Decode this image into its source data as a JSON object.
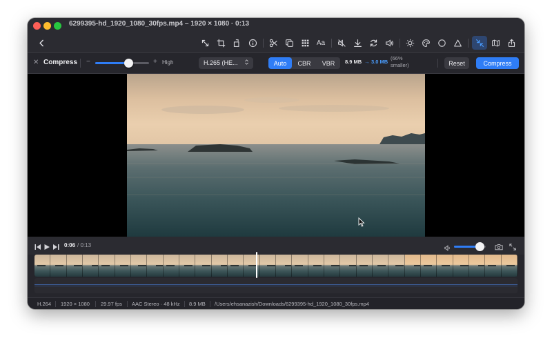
{
  "window": {
    "title": "6299395-hd_1920_1080_30fps.mp4 – 1920 × 1080 · 0:13"
  },
  "toolbar": {
    "back_icon": "chevron-left-icon",
    "tools": [
      {
        "name": "resize-icon"
      },
      {
        "name": "crop-icon"
      },
      {
        "name": "rotate-icon"
      },
      {
        "name": "info-icon"
      },
      {
        "name": "scissors-icon"
      },
      {
        "name": "duplicate-icon"
      },
      {
        "name": "grid-icon"
      },
      {
        "name": "text-icon",
        "label": "Aa"
      },
      {
        "name": "mute-icon"
      },
      {
        "name": "download-icon"
      },
      {
        "name": "loop-icon"
      },
      {
        "name": "volume-icon"
      },
      {
        "name": "brightness-icon"
      },
      {
        "name": "palette-icon"
      },
      {
        "name": "circle-icon"
      },
      {
        "name": "triangle-icon"
      },
      {
        "name": "compress-icon"
      },
      {
        "name": "map-icon"
      },
      {
        "name": "share-icon"
      }
    ],
    "active_tool": "compress-icon",
    "text_tool_label": "Aa"
  },
  "compress": {
    "close_glyph": "✕",
    "title": "Compress",
    "minus": "−",
    "plus": "+",
    "quality_label": "High",
    "quality_level": 0.62,
    "codec": "H.265 (HE...",
    "modes": [
      "Auto",
      "CBR",
      "VBR"
    ],
    "selected_mode": "Auto",
    "original_size": "8.9 MB",
    "arrow": "→",
    "new_size": "3.0 MB",
    "savings": "(66% smaller)",
    "reset_label": "Reset",
    "compress_label": "Compress"
  },
  "player": {
    "current_time": "0:06",
    "total_time": "/ 0:13",
    "volume": 0.8,
    "playhead_fraction": 0.46
  },
  "status": {
    "codec": "H.264",
    "resolution": "1920 × 1080",
    "fps": "29.97 fps",
    "audio": "AAC Stereo · 48 kHz",
    "size": "8.9 MB",
    "path": "/Users/ehsanazish/Downloads/6299395-hd_1920_1080_30fps.mp4"
  },
  "colors": {
    "accent": "#2f7df6",
    "new_size": "#4a9dff",
    "window_bg": "#232329"
  }
}
